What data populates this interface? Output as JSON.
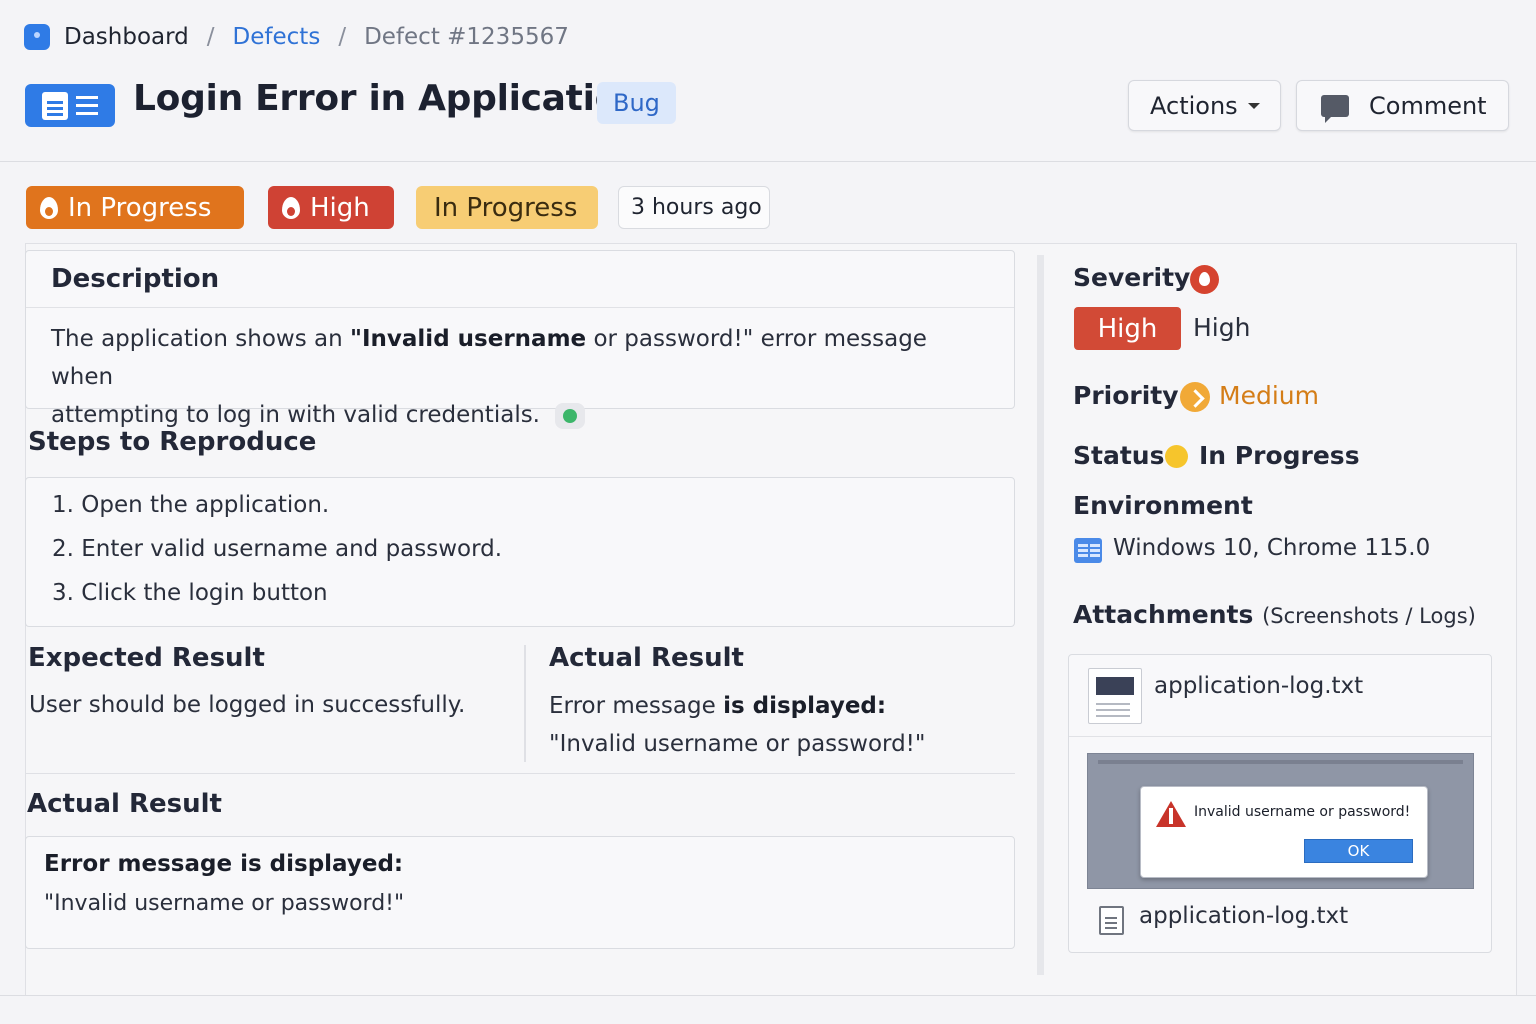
{
  "breadcrumb": {
    "home": "Dashboard",
    "section": "Defects",
    "current": "Defect #1235567",
    "separator": "/"
  },
  "header": {
    "title": "Login Error in Application",
    "type_badge": "Bug",
    "actions_label": "Actions",
    "comment_label": "Comment"
  },
  "chips": {
    "progress": "In Progress",
    "priority": "High",
    "state": "In Progress",
    "time": "3 hours ago"
  },
  "description": {
    "heading": "Description",
    "pre": "The application shows an ",
    "strong": "\"Invalid username",
    "mid": " or password!\" error message when",
    "line2": "attempting to log in with valid credentials."
  },
  "steps": {
    "heading": "Steps to Reproduce",
    "items": [
      "1. Open the application.",
      "2. Enter valid username and password.",
      "3. Click the login button"
    ]
  },
  "expected": {
    "heading": "Expected Result",
    "text": "User should be logged in successfully."
  },
  "actual_inline": {
    "heading": "Actual Result",
    "pre": "Error message ",
    "strong": "is displayed:",
    "quote": "\"Invalid username or password!\""
  },
  "actual_panel": {
    "heading": "Actual Result",
    "strong": "Error message is displayed:",
    "quote": "\"Invalid username or password!\""
  },
  "sidebar": {
    "severity_label": "Severity",
    "severity_badge": "High",
    "severity_text": "High",
    "priority_label": "Priority",
    "priority_value": "Medium",
    "status_label": "Status",
    "status_value": "In Progress",
    "environment_label": "Environment",
    "environment_value": "Windows 10, Chrome 115.0",
    "attachments_label": "Attachments",
    "attachments_sub": "(Screenshots / Logs)"
  },
  "attachments": {
    "file1": "application-log.txt",
    "dialog_message": "Invalid username or password!",
    "dialog_ok": "OK",
    "file2": "application-log.txt"
  },
  "colors": {
    "accent": "#2f7be6",
    "chip_progress": "#e0741d",
    "chip_high": "#cf4234",
    "chip_state": "#f7cd74",
    "priority_medium": "#d47d17",
    "status_dot": "#f6c52c"
  },
  "icons": {
    "app": "app-icon",
    "title": "document-list-icon",
    "comment": "chat-bubble-icon",
    "severity": "flame-icon",
    "priority": "arrow-right-icon",
    "environment": "window-icon",
    "attachment": "file-icon",
    "warning": "warning-icon"
  }
}
